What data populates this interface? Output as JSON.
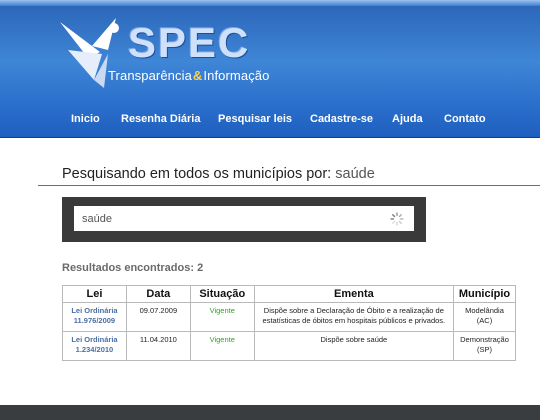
{
  "brand": {
    "logo_word": "SPEC",
    "tagline_part1": "Transparência",
    "tagline_amp": "&",
    "tagline_part2": "Informação"
  },
  "nav": {
    "items": [
      {
        "label": "Inicio"
      },
      {
        "label": "Resenha Diária"
      },
      {
        "label": "Pesquisar leis"
      },
      {
        "label": "Cadastre-se"
      },
      {
        "label": "Ajuda"
      },
      {
        "label": "Contato"
      }
    ]
  },
  "search": {
    "heading": "Pesquisando em todos os municípios por:",
    "term": "saúde",
    "input_value": "saúde"
  },
  "results": {
    "count_label": "Resultados encontrados: 2",
    "columns": [
      "Lei",
      "Data",
      "Situação",
      "Ementa",
      "Município"
    ],
    "rows": [
      {
        "lei_line1": "Lei Ordinária",
        "lei_line2": "11.976/2009",
        "data": "09.07.2009",
        "situacao": "Vigente",
        "ementa": "Dispõe sobre a Declaração de Óbito e a realização de estatísticas de óbitos em hospitais públicos e privados.",
        "municipio_line1": "Modelândia",
        "municipio_line2": "(AC)"
      },
      {
        "lei_line1": "Lei Ordinária",
        "lei_line2": "1.234/2010",
        "data": "11.04.2010",
        "situacao": "Vigente",
        "ementa": "Dispõe sobre saúde",
        "municipio_line1": "Demonstração",
        "municipio_line2": "(SP)"
      }
    ]
  },
  "colors": {
    "header_blue": "#2b70cc",
    "link_blue": "#4a6fa5",
    "status_green": "#2fa51f",
    "search_frame": "#3a3a3a",
    "footer": "#3a3d40"
  },
  "icons": {
    "logo": "spec-bird-logo-icon",
    "loading": "loading-spinner-icon"
  }
}
